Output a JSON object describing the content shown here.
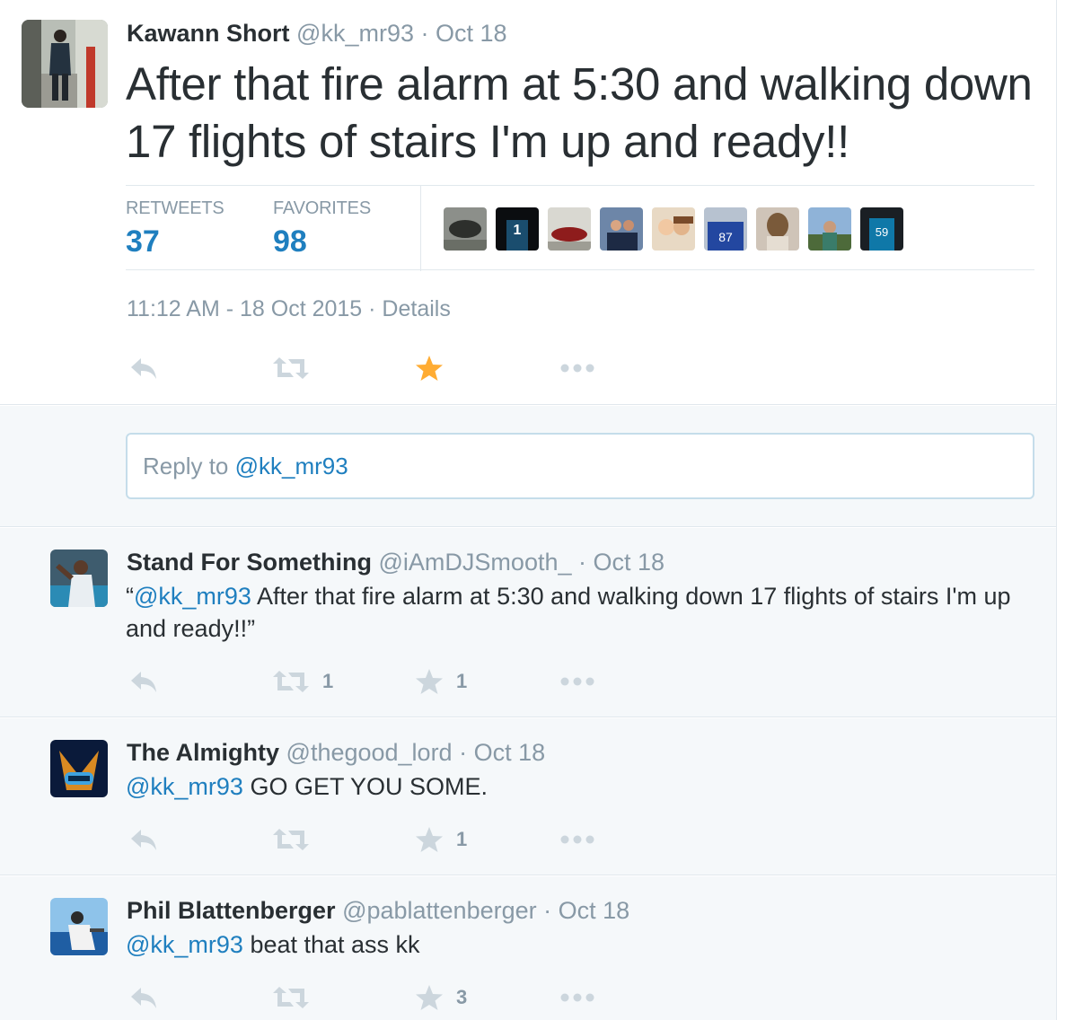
{
  "main_tweet": {
    "fullname": "Kawann Short",
    "handle": "@kk_mr93",
    "date": "Oct 18",
    "text": "After that fire alarm at 5:30 and walking down 17 flights of stairs I'm up and ready!!",
    "retweets_label": "RETWEETS",
    "retweets_count": "37",
    "favorites_label": "FAVORITES",
    "favorites_count": "98",
    "timestamp": "11:12 AM - 18 Oct 2015",
    "details_label": "Details",
    "favorited": true
  },
  "reply_box": {
    "prefix": "Reply to ",
    "mention": "@kk_mr93"
  },
  "replies": [
    {
      "fullname": "Stand For Something",
      "handle": "@iAmDJSmooth_",
      "date": "Oct 18",
      "quote_open": "“",
      "mention": "@kk_mr93",
      "text": " After that fire alarm at 5:30 and walking down 17 flights of stairs I'm up and ready!!”",
      "retweet_count": "1",
      "favorite_count": "1"
    },
    {
      "fullname": "The Almighty",
      "handle": "@thegood_lord",
      "date": "Oct 18",
      "quote_open": "",
      "mention": "@kk_mr93",
      "text": " GO GET YOU SOME.",
      "retweet_count": "",
      "favorite_count": "1"
    },
    {
      "fullname": "Phil Blattenberger",
      "handle": "@pablattenberger",
      "date": "Oct 18",
      "quote_open": "",
      "mention": "@kk_mr93",
      "text": " beat that ass kk",
      "retweet_count": "",
      "favorite_count": "3"
    }
  ],
  "separator": " · ",
  "icons": {
    "reply": "reply-icon",
    "retweet": "retweet-icon",
    "favorite": "star-icon",
    "more": "more-icon"
  },
  "colors": {
    "link": "#1f7fbf",
    "muted": "#8899a6",
    "favorite_active": "#ffac33",
    "icon_inactive": "#ccd6dd"
  }
}
